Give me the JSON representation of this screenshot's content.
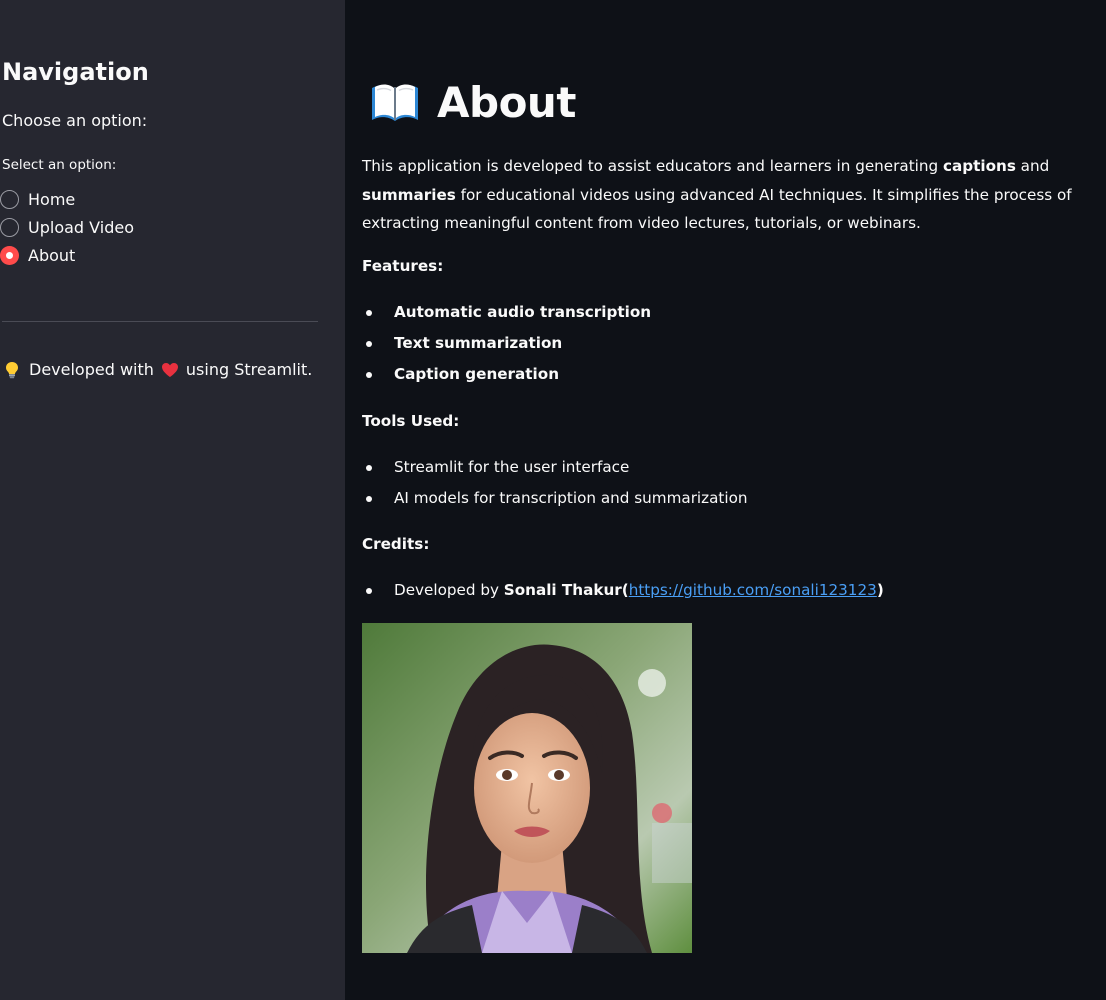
{
  "sidebar": {
    "title": "Navigation",
    "subtitle": "Choose an option:",
    "radio_label": "Select an option:",
    "options": [
      "Home",
      "Upload Video",
      "About"
    ],
    "selected": "About",
    "footer_prefix": "Developed with",
    "footer_suffix": "using Streamlit."
  },
  "main": {
    "title": "About",
    "intro_1": "This application is developed to assist educators and learners in generating ",
    "intro_bold_1": "captions",
    "intro_2": " and ",
    "intro_bold_2": "summaries",
    "intro_3": " for educational videos using advanced AI techniques. It simplifies the process of extracting meaningful content from video lectures, tutorials, or webinars.",
    "features_heading": "Features:",
    "features": [
      "Automatic audio transcription",
      "Text summarization",
      "Caption generation"
    ],
    "tools_heading": "Tools Used:",
    "tools": [
      "Streamlit for the user interface",
      "AI models for transcription and summarization"
    ],
    "credits_heading": "Credits:",
    "credit_prefix": "Developed by ",
    "credit_name": "Sonali Thakur",
    "credit_open": "(",
    "credit_link": "https://github.com/sonali123123",
    "credit_close": ")"
  },
  "colors": {
    "sidebar_bg": "#262730",
    "main_bg": "#0e1117",
    "accent": "#ff4b4b",
    "link": "#4a9ff5"
  },
  "icons": [
    "book-icon",
    "lightbulb-icon",
    "heart-icon"
  ]
}
